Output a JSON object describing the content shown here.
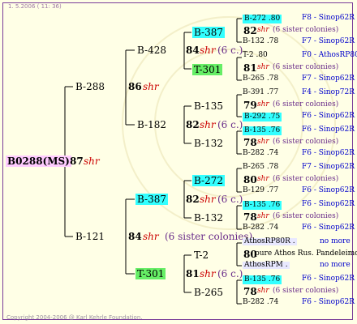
{
  "header_text": "1.  5.2006 ( 11: 36)",
  "footer_text": "Copyright 2004-2006 @ Karl Kehrle Foundation.",
  "root": {
    "id": "B0288(MS)",
    "num": "87",
    "race": "shr"
  },
  "gen1": [
    {
      "id": "B-288"
    },
    {
      "id": "B-121"
    }
  ],
  "gen2": [
    {
      "num": "86",
      "race": "shr"
    },
    {
      "num": "84",
      "race": "shr",
      "note": "(6 sister colonies)"
    }
  ],
  "gen3": [
    {
      "id": "B-428"
    },
    {
      "id": "B-182"
    },
    {
      "id": "B-387"
    },
    {
      "id": "T-301"
    }
  ],
  "gen3_labels": [
    {
      "num": "84",
      "race": "shr",
      "note": "(6 c.)"
    },
    {
      "num": "82",
      "race": "shr",
      "note": "(6 c.)"
    },
    {
      "num": "82",
      "race": "shr",
      "note": "(6 c.)"
    },
    {
      "num": "81",
      "race": "shr",
      "note": "(6 c.)"
    }
  ],
  "gen4": [
    {
      "id": "B-387"
    },
    {
      "id": "T-301"
    },
    {
      "id": "B-135"
    },
    {
      "id": "B-132"
    },
    {
      "id": "B-272"
    },
    {
      "id": "B-132"
    },
    {
      "id": "T-2"
    },
    {
      "id": "B-265"
    }
  ],
  "gen5": [
    {
      "top_id": "B-272 .80",
      "top_tag": "F8 - Sinop62R",
      "num": "82",
      "race": "shr",
      "note": "(6 sister colonies)",
      "bot_id": "B-132 .78",
      "bot_tag": "F7 - Sinop62R"
    },
    {
      "top_id": "T-2 .80",
      "top_tag": "F0 - AthosRP80R",
      "num": "81",
      "race": "shr",
      "note": "(6 sister colonies)",
      "bot_id": "B-265 .78",
      "bot_tag": "F7 - Sinop62R"
    },
    {
      "top_id": "B-391 .77",
      "top_tag": "F4 - Sinop72R",
      "num": "79",
      "race": "shr",
      "note": "(6 sister colonies)",
      "bot_id": "B-292 .75",
      "bot_tag": "F6 - Sinop62R"
    },
    {
      "top_id": "B-135 .76",
      "top_tag": "F6 - Sinop62R",
      "num": "78",
      "race": "shr",
      "note": "(6 sister colonies)",
      "bot_id": "B-282 .74",
      "bot_tag": "F6 - Sinop62R"
    },
    {
      "top_id": "B-265 .78",
      "top_tag": "F7 - Sinop62R",
      "num": "80",
      "race": "shr",
      "note": "(6 sister colonies)",
      "bot_id": "B-129 .77",
      "bot_tag": "F6 - Sinop62R"
    },
    {
      "top_id": "B-135 .76",
      "top_tag": "F6 - Sinop62R",
      "num": "78",
      "race": "shr",
      "note": "(6 sister colonies)",
      "bot_id": "B-282 .74",
      "bot_tag": "F6 - Sinop62R"
    },
    {
      "top_id": "AthosRP80R .",
      "top_tag": "no more",
      "num": "80",
      "race": "pure Athos Rus. Pandeleimonos",
      "note": "",
      "bot_id": "AthosRPM .",
      "bot_tag": "no more"
    },
    {
      "top_id": "B-135 .76",
      "top_tag": "F6 - Sinop62R",
      "num": "78",
      "race": "shr",
      "note": "(6 sister colonies)",
      "bot_id": "B-282 .74",
      "bot_tag": "F6 - Sinop62R"
    }
  ]
}
